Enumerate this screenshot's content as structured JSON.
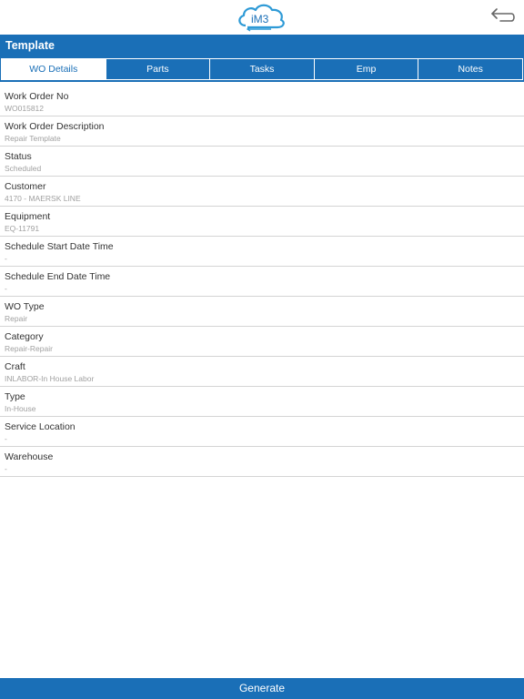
{
  "header": {
    "logo_text": "iM3",
    "back_icon": "back-arrow-icon"
  },
  "title": "Template",
  "tabs": [
    {
      "label": "WO Details",
      "active": true
    },
    {
      "label": "Parts",
      "active": false
    },
    {
      "label": "Tasks",
      "active": false
    },
    {
      "label": "Emp",
      "active": false
    },
    {
      "label": "Notes",
      "active": false
    }
  ],
  "fields": [
    {
      "label": "Work Order No",
      "value": "WO015812"
    },
    {
      "label": "Work Order Description",
      "value": "Repair Template"
    },
    {
      "label": "Status",
      "value": "Scheduled"
    },
    {
      "label": "Customer",
      "value": "4170 - MAERSK LINE"
    },
    {
      "label": "Equipment",
      "value": "EQ-11791"
    },
    {
      "label": "Schedule Start Date Time",
      "value": "-"
    },
    {
      "label": "Schedule End Date Time",
      "value": "-"
    },
    {
      "label": "WO Type",
      "value": "Repair"
    },
    {
      "label": "Category",
      "value": "Repair-Repair"
    },
    {
      "label": "Craft",
      "value": "INLABOR-In House Labor"
    },
    {
      "label": "Type",
      "value": "In-House"
    },
    {
      "label": "Service Location",
      "value": "-"
    },
    {
      "label": "Warehouse",
      "value": "-"
    }
  ],
  "footer": {
    "generate_label": "Generate"
  },
  "colors": {
    "primary": "#1a6fb7",
    "label_text": "#333333",
    "value_text": "#a0a0a0",
    "divider": "#d4d4d4"
  }
}
